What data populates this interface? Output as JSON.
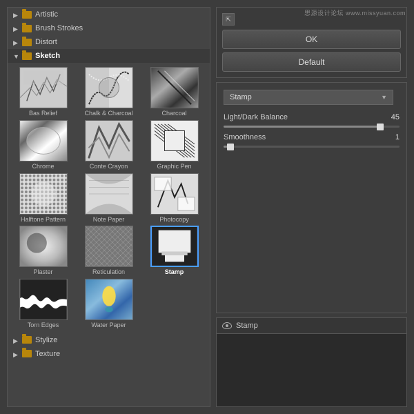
{
  "watermark": "思源设计论坛 www.missyuan.com",
  "left_panel": {
    "tree_items": [
      {
        "label": "Artistic",
        "expanded": false
      },
      {
        "label": "Brush Strokes",
        "expanded": false
      },
      {
        "label": "Distort",
        "expanded": false
      },
      {
        "label": "Sketch",
        "expanded": true
      }
    ],
    "sketch_filters": [
      {
        "label": "Bas Relief",
        "key": "bas-relief",
        "selected": false
      },
      {
        "label": "Chalk & Charcoal",
        "key": "chalk-charcoal",
        "selected": false
      },
      {
        "label": "Charcoal",
        "key": "charcoal",
        "selected": false
      },
      {
        "label": "Chrome",
        "key": "chrome",
        "selected": false
      },
      {
        "label": "Conte Crayon",
        "key": "conte-crayon",
        "selected": false
      },
      {
        "label": "Graphic Pen",
        "key": "graphic-pen",
        "selected": false
      },
      {
        "label": "Halftone Pattern",
        "key": "halftone",
        "selected": false
      },
      {
        "label": "Note Paper",
        "key": "note-paper",
        "selected": false
      },
      {
        "label": "Photocopy",
        "key": "photocopy",
        "selected": false
      },
      {
        "label": "Plaster",
        "key": "plaster",
        "selected": false
      },
      {
        "label": "Reticulation",
        "key": "reticulation",
        "selected": false
      },
      {
        "label": "Stamp",
        "key": "stamp",
        "selected": true
      },
      {
        "label": "Torn Edges",
        "key": "torn-edges",
        "selected": false
      },
      {
        "label": "Water Paper",
        "key": "water-paper",
        "selected": false
      }
    ],
    "bottom_tree_items": [
      {
        "label": "Stylize"
      },
      {
        "label": "Texture"
      }
    ]
  },
  "right_panel": {
    "buttons": {
      "ok": "OK",
      "default": "Default"
    },
    "settings": {
      "filter_name": "Stamp",
      "params": [
        {
          "label": "Light/Dark Balance",
          "value": 45,
          "min": 0,
          "max": 50,
          "fill_pct": 90
        },
        {
          "label": "Smoothness",
          "value": 1,
          "min": 1,
          "max": 14,
          "fill_pct": 5
        }
      ]
    },
    "preview": {
      "label": "Stamp"
    }
  }
}
